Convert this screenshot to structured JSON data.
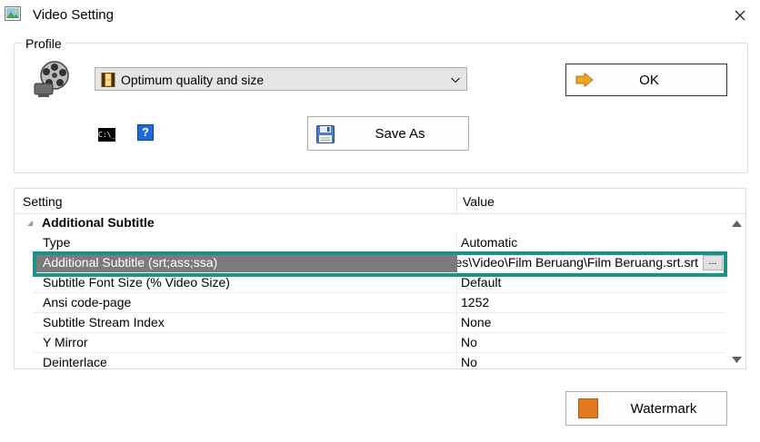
{
  "window": {
    "title": "Video Setting",
    "app_icon": "picture-icon",
    "close_icon": "close-icon"
  },
  "profile": {
    "group_label": "Profile",
    "selected_profile": "Optimum quality and size",
    "ok_label": "OK",
    "save_as_label": "Save As",
    "help_glyph": "?",
    "cmd_glyph": "C:\\_"
  },
  "grid": {
    "col_setting": "Setting",
    "col_value": "Value",
    "category": "Additional Subtitle",
    "rows": [
      {
        "name": "Type",
        "value": "Automatic"
      },
      {
        "name": "Additional Subtitle (srt;ass;ssa)",
        "value": "es\\Video\\Film Beruang\\Film Beruang.srt.srt"
      },
      {
        "name": "Subtitle Font Size (% Video Size)",
        "value": "Default"
      },
      {
        "name": "Ansi code-page",
        "value": "1252"
      },
      {
        "name": "Subtitle Stream Index",
        "value": "None"
      },
      {
        "name": "Y Mirror",
        "value": "No"
      },
      {
        "name": "Deinterlace",
        "value": "No"
      }
    ],
    "ellipsis_label": "..."
  },
  "watermark": {
    "label": "Watermark"
  },
  "colors": {
    "highlight": "#139688",
    "selected_row": "#7b7b7b",
    "help_blue": "#1e6ad8",
    "ok_arrow": "#f3a623",
    "watermark_orange": "#e07a1f"
  }
}
